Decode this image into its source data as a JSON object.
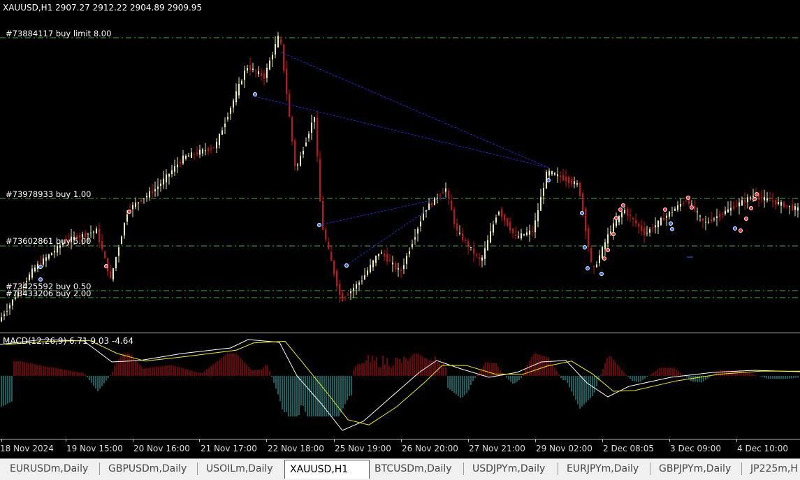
{
  "window": {
    "symbol_header": "XAUUSD,H1  2907.27 2912.22 2904.89 2909.95"
  },
  "orders": [
    {
      "label": "#73884117 buy limit 8.00",
      "price_line": "order-line"
    },
    {
      "label": "#73978933 buy 1.00",
      "price_line": "order-line"
    },
    {
      "label": "#73602861 buy 5.00",
      "price_line": "order-line"
    },
    {
      "label": "#73425592 buy 0.50",
      "price_line": "order-line"
    },
    {
      "label": "#73433206 buy 2.00",
      "price_line": "order-line"
    }
  ],
  "macd": {
    "label": "MACD(12,26,9) 6.71 9.03 -4.64"
  },
  "time_axis": {
    "labels": [
      "18 Nov 2024",
      "19 Nov 15:00",
      "20 Nov 16:00",
      "21 Nov 17:00",
      "22 Nov 18:00",
      "25 Nov 19:00",
      "26 Nov 20:00",
      "27 Nov 21:00",
      "29 Nov 02:00",
      "2 Dec 08:05",
      "3 Dec 09:00",
      "4 Dec 10:00"
    ]
  },
  "tabs": [
    {
      "label": "EURUSDm,Daily",
      "active": false
    },
    {
      "label": "GBPUSDm,Daily",
      "active": false
    },
    {
      "label": "USOILm,Daily",
      "active": false
    },
    {
      "label": "XAUUSD,H1",
      "active": true
    },
    {
      "label": "BTCUSDm,Daily",
      "active": false
    },
    {
      "label": "USDJPYm,Daily",
      "active": false
    },
    {
      "label": "EURJPYm,Daily",
      "active": false
    },
    {
      "label": "GBPJPYm,Daily",
      "active": false
    },
    {
      "label": "JP225m,H",
      "active": false
    }
  ],
  "colors": {
    "background": "#000000",
    "bull_candle": "#f0f08c",
    "bear_candle": "#d01010",
    "order_line": "#3cb43c",
    "trendline": "#2828d0",
    "macd_hist_pos": "#d01010",
    "macd_hist_neg": "#30c0c0",
    "macd_line": "#ffffff",
    "signal_line": "#f0f000",
    "tab_bar": "#f0f0f0"
  }
}
